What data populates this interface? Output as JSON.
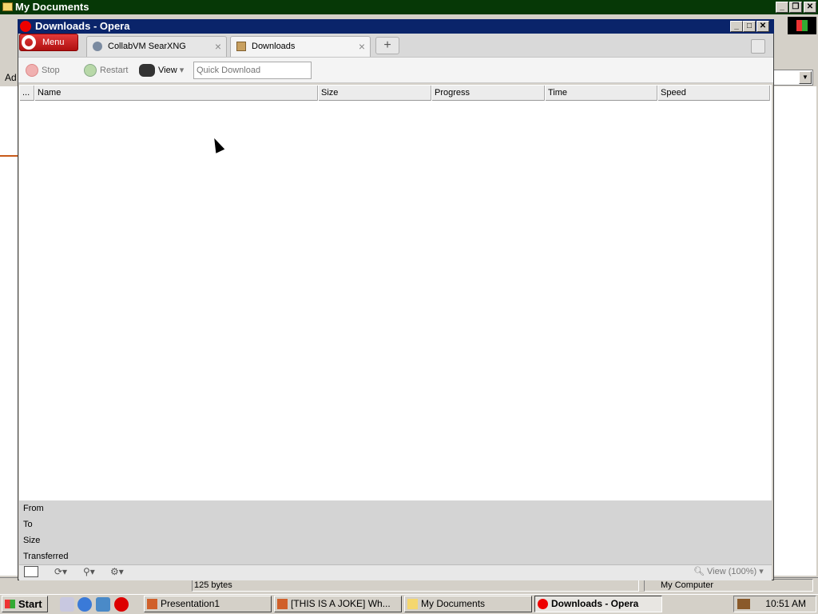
{
  "bg_window": {
    "title": "My Documents",
    "address_label": "Ad",
    "status_size": "125 bytes",
    "status_location": "My Computer"
  },
  "opera": {
    "title": "Downloads - Opera",
    "menu_label": "Menu",
    "tabs": [
      {
        "label": "CollabVM SearXNG",
        "active": false
      },
      {
        "label": "Downloads",
        "active": true
      }
    ],
    "new_tab_label": "+",
    "toolbar": {
      "stop_label": "Stop",
      "restart_label": "Restart",
      "view_label": "View",
      "quick_download_placeholder": "Quick Download"
    },
    "columns": [
      "...",
      "Name",
      "Size",
      "Progress",
      "Time",
      "Speed"
    ],
    "details": {
      "from_label": "From",
      "to_label": "To",
      "size_label": "Size",
      "transferred_label": "Transferred"
    },
    "zoom_label": "View (100%)"
  },
  "taskbar": {
    "start_label": "Start",
    "tasks": [
      {
        "label": "Presentation1"
      },
      {
        "label": "[THIS IS A JOKE] Wh..."
      },
      {
        "label": "My Documents"
      },
      {
        "label": "Downloads - Opera"
      }
    ],
    "clock": "10:51 AM"
  },
  "colors": {
    "opera_titlebar": "#0a246a",
    "bg_titlebar": "#063806",
    "menu_button": "#c41818"
  }
}
